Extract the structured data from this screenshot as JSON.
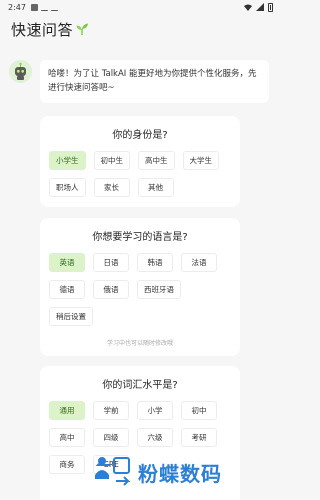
{
  "status_bar": {
    "time": "2:47"
  },
  "header": {
    "title": "快速问答"
  },
  "intro": {
    "message": "哈喽！为了让 TalkAI 能更好地为你提供个性化服务，先进行快速问答吧~"
  },
  "q1": {
    "title": "你的身份是?",
    "options": [
      "小学生",
      "初中生",
      "高中生",
      "大学生",
      "职场人",
      "家长",
      "其他"
    ],
    "selected": "小学生"
  },
  "q2": {
    "title": "你想要学习的语言是?",
    "options": [
      "英语",
      "日语",
      "韩语",
      "法语",
      "德语",
      "俄语",
      "西班牙语",
      "稍后设置"
    ],
    "selected": "英语",
    "hint": "学习中也可以随时修改哦"
  },
  "q3": {
    "title": "你的词汇水平是?",
    "options": [
      "通用",
      "学前",
      "小学",
      "初中",
      "高中",
      "四级",
      "六级",
      "考研",
      "商务",
      "GRE"
    ],
    "selected": "通用"
  },
  "watermark": {
    "text": "粉蝶数码"
  },
  "colors": {
    "accent": "#dcf3c9",
    "accent_text": "#2f6b1c",
    "sprout": "#7cc84a",
    "watermark": "#2b7fd6"
  }
}
